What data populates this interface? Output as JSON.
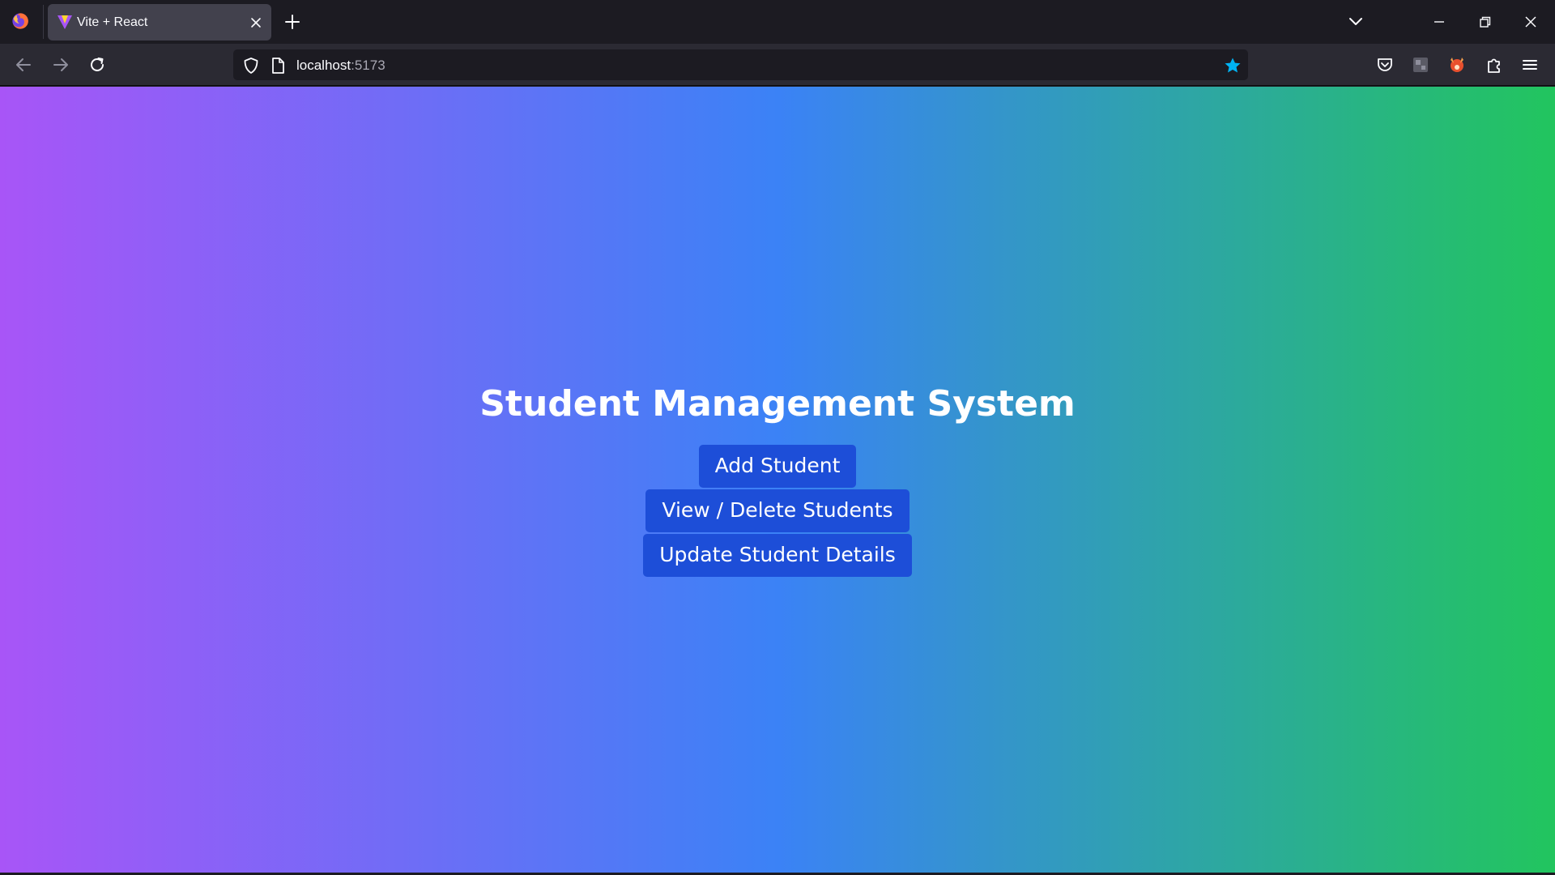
{
  "browser": {
    "tab": {
      "title": "Vite + React"
    },
    "url": {
      "host": "localhost",
      "port": ":5173"
    },
    "icons": {
      "logo": "firefox-logo-icon",
      "favicon": "vite-favicon-icon",
      "close_tab": "close-icon",
      "new_tab": "plus-icon",
      "tab_list": "chevron-down-icon",
      "back": "arrow-left-icon",
      "forward": "arrow-right-icon",
      "reload": "reload-icon",
      "shield": "shield-icon",
      "page": "page-icon",
      "bookmark": "star-icon",
      "pocket": "pocket-icon",
      "extension_box": "extension-icon",
      "extension_fox": "fox-icon",
      "extensions": "puzzle-icon",
      "menu": "hamburger-menu-icon"
    }
  },
  "page": {
    "title": "Student Management System",
    "buttons": [
      {
        "label": "Add Student"
      },
      {
        "label": "View / Delete Students"
      },
      {
        "label": "Update Student Details"
      }
    ]
  },
  "colors": {
    "gradient_start": "#a855f7",
    "gradient_mid": "#3b82f6",
    "gradient_end": "#22c55e",
    "button_bg": "#1d4ed8",
    "bookmark_star": "#00b3f4"
  }
}
